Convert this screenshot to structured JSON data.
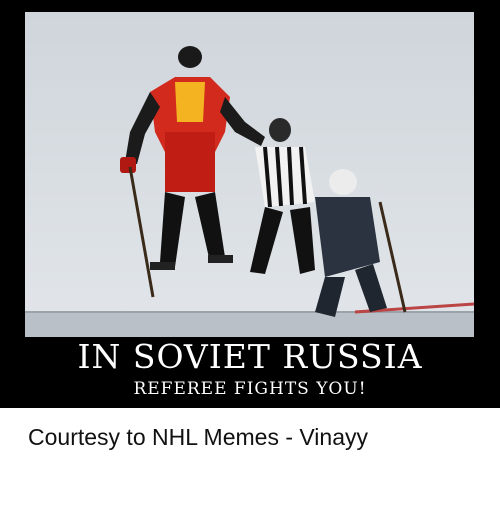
{
  "poster": {
    "title": "IN SOVIET RUSSIA",
    "subtitle": "REFEREE FIGHTS YOU!"
  },
  "caption": {
    "text": "Courtesy to NHL Memes - Vinayy"
  },
  "colors": {
    "background": "#ffffff",
    "poster_frame": "#000000",
    "poster_text": "#ffffff",
    "caption_text": "#111111",
    "ice": "#d8dde2"
  }
}
